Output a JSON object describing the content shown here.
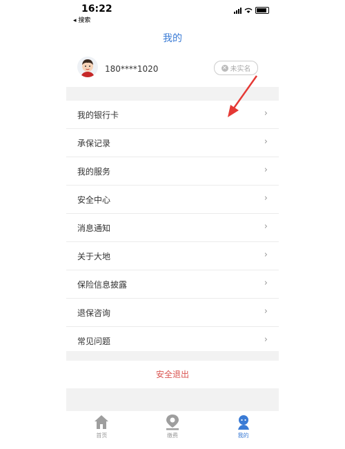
{
  "status_bar": {
    "time": "16:22",
    "back_label": "◂ 搜索"
  },
  "header": {
    "title": "我的"
  },
  "profile": {
    "phone": "180****1020",
    "badge_label": "未实名"
  },
  "menu": [
    {
      "label": "我的银行卡"
    },
    {
      "label": "承保记录"
    },
    {
      "label": "我的服务"
    },
    {
      "label": "安全中心"
    },
    {
      "label": "消息通知"
    },
    {
      "label": "关于大地"
    },
    {
      "label": "保险信息披露"
    },
    {
      "label": "退保咨询"
    },
    {
      "label": "常见问题"
    }
  ],
  "logout_label": "安全退出",
  "tabbar": {
    "tabs": [
      {
        "label": "首页"
      },
      {
        "label": "缴费"
      },
      {
        "label": "我的"
      }
    ]
  },
  "colors": {
    "accent": "#3a7bd5",
    "logout": "#d9534f",
    "annotation": "#e53935"
  }
}
